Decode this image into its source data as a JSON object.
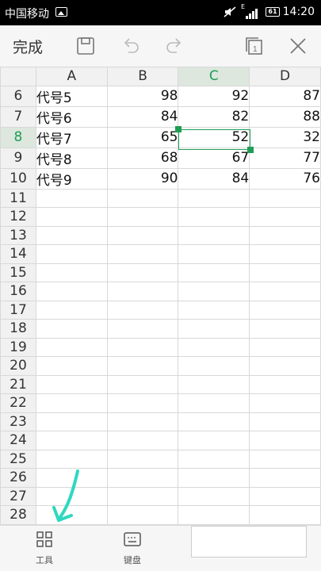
{
  "status_bar": {
    "carrier": "中国移动",
    "network": "E",
    "battery": "61",
    "time": "14:20"
  },
  "toolbar": {
    "done_label": "完成",
    "icons": [
      "save-icon",
      "undo-icon",
      "redo-icon",
      "sheet-switch-icon",
      "close-icon"
    ],
    "sheet_badge": "1"
  },
  "sheet": {
    "columns": [
      "A",
      "B",
      "C",
      "D"
    ],
    "active_column": "C",
    "active_row": "8",
    "rows": [
      {
        "num": "6",
        "cells": [
          "代号5",
          "98",
          "92",
          "87"
        ]
      },
      {
        "num": "7",
        "cells": [
          "代号6",
          "84",
          "82",
          "88"
        ]
      },
      {
        "num": "8",
        "cells": [
          "代号7",
          "65",
          "52",
          "32"
        ]
      },
      {
        "num": "9",
        "cells": [
          "代号8",
          "68",
          "67",
          "77"
        ]
      },
      {
        "num": "10",
        "cells": [
          "代号9",
          "90",
          "84",
          "76"
        ]
      },
      {
        "num": "11",
        "cells": [
          "",
          "",
          "",
          ""
        ]
      },
      {
        "num": "12",
        "cells": [
          "",
          "",
          "",
          ""
        ]
      },
      {
        "num": "13",
        "cells": [
          "",
          "",
          "",
          ""
        ]
      },
      {
        "num": "14",
        "cells": [
          "",
          "",
          "",
          ""
        ]
      },
      {
        "num": "15",
        "cells": [
          "",
          "",
          "",
          ""
        ]
      },
      {
        "num": "16",
        "cells": [
          "",
          "",
          "",
          ""
        ]
      },
      {
        "num": "17",
        "cells": [
          "",
          "",
          "",
          ""
        ]
      },
      {
        "num": "18",
        "cells": [
          "",
          "",
          "",
          ""
        ]
      },
      {
        "num": "19",
        "cells": [
          "",
          "",
          "",
          ""
        ]
      },
      {
        "num": "20",
        "cells": [
          "",
          "",
          "",
          ""
        ]
      },
      {
        "num": "21",
        "cells": [
          "",
          "",
          "",
          ""
        ]
      },
      {
        "num": "22",
        "cells": [
          "",
          "",
          "",
          ""
        ]
      },
      {
        "num": "23",
        "cells": [
          "",
          "",
          "",
          ""
        ]
      },
      {
        "num": "24",
        "cells": [
          "",
          "",
          "",
          ""
        ]
      },
      {
        "num": "25",
        "cells": [
          "",
          "",
          "",
          ""
        ]
      },
      {
        "num": "26",
        "cells": [
          "",
          "",
          "",
          ""
        ]
      },
      {
        "num": "27",
        "cells": [
          "",
          "",
          "",
          ""
        ]
      },
      {
        "num": "28",
        "cells": [
          "",
          "",
          "",
          ""
        ]
      }
    ]
  },
  "bottom_bar": {
    "tools_label": "工具",
    "keyboard_label": "键盘"
  },
  "colors": {
    "accent": "#1f9d55",
    "arrow": "#2ed8c0"
  }
}
